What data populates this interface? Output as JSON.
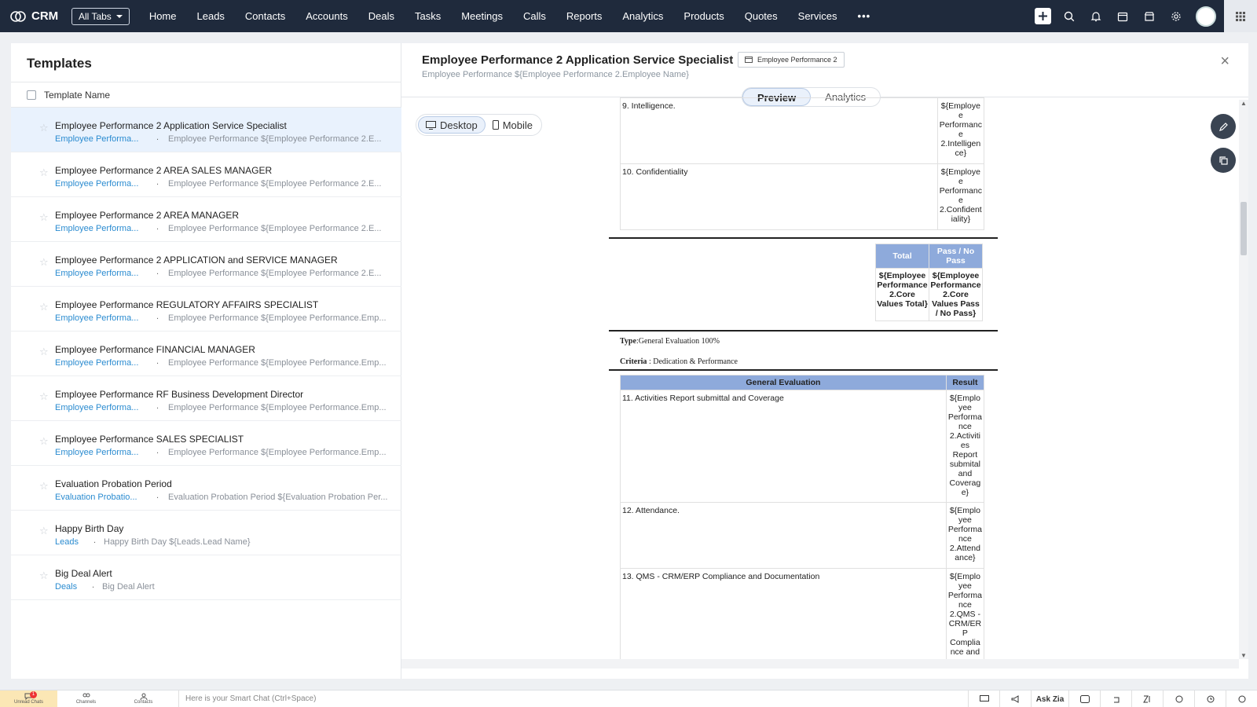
{
  "topbar": {
    "brand": "CRM",
    "all_tabs": "All Tabs",
    "nav": [
      "Home",
      "Leads",
      "Contacts",
      "Accounts",
      "Deals",
      "Tasks",
      "Meetings",
      "Calls",
      "Reports",
      "Analytics",
      "Products",
      "Quotes",
      "Services"
    ],
    "more": "•••",
    "icons": [
      "plus-icon",
      "search-icon",
      "bell-icon",
      "calendar-icon",
      "store-icon",
      "gear-icon",
      "avatar",
      "apps-grid-icon"
    ]
  },
  "templates": {
    "title": "Templates",
    "column_header": "Template Name",
    "items": [
      {
        "name": "Employee Performance 2 Application Service Specialist",
        "module": "Employee Performa...",
        "subject": "Employee Performance ${Employee Performance 2.E..."
      },
      {
        "name": "Employee Performance 2 AREA SALES MANAGER",
        "module": "Employee Performa...",
        "subject": "Employee Performance ${Employee Performance 2.E..."
      },
      {
        "name": "Employee Performance 2 AREA MANAGER",
        "module": "Employee Performa...",
        "subject": "Employee Performance ${Employee Performance 2.E..."
      },
      {
        "name": "Employee Performance 2 APPLICATION and SERVICE MANAGER",
        "module": "Employee Performa...",
        "subject": "Employee Performance ${Employee Performance 2.E..."
      },
      {
        "name": "Employee Performance REGULATORY AFFAIRS SPECIALIST",
        "module": "Employee Performa...",
        "subject": "Employee Performance ${Employee Performance.Emp..."
      },
      {
        "name": "Employee Performance FINANCIAL MANAGER",
        "module": "Employee Performa...",
        "subject": "Employee Performance ${Employee Performance.Emp..."
      },
      {
        "name": "Employee Performance RF Business Development Director",
        "module": "Employee Performa...",
        "subject": "Employee Performance ${Employee Performance.Emp..."
      },
      {
        "name": "Employee Performance SALES SPECIALIST",
        "module": "Employee Performa...",
        "subject": "Employee Performance ${Employee Performance.Emp..."
      },
      {
        "name": "Evaluation Probation Period",
        "module": "Evaluation Probatio...",
        "subject": "Evaluation Probation Period ${Evaluation Probation Per..."
      },
      {
        "name": "Happy Birth Day",
        "module": "Leads",
        "subject": "Happy Birth Day ${Leads.Lead Name}"
      },
      {
        "name": "Big Deal Alert",
        "module": "Deals",
        "subject": "Big Deal Alert"
      }
    ],
    "dot": "."
  },
  "preview": {
    "title": "Employee Performance 2 Application Service Specialist",
    "module_badge": "Employee Performance 2",
    "subject": "Employee Performance ${Employee Performance 2.Employee Name}",
    "close": "×",
    "tabs": [
      "Preview",
      "Analytics"
    ],
    "devices": [
      "Desktop",
      "Mobile"
    ]
  },
  "document": {
    "rows_a": [
      {
        "label": "9. Intelligence.",
        "result": "${Employe e Performanc e 2.Intelligen ce}"
      },
      {
        "label": "10. Confidentiality",
        "result": "${Employe e Performanc e 2.Confident iality}"
      }
    ],
    "totals": {
      "headers": [
        "Total",
        "Pass / No Pass"
      ],
      "values": [
        "${Employee Performance 2.Core Values Total}",
        "${Employee Performance 2.Core Values Pass / No Pass}"
      ]
    },
    "type_label": "Type",
    "type_value": ":General  Evaluation 100%",
    "criteria_label": "Criteria",
    "criteria_value": " : Dedication & Performance",
    "table_b_headers": [
      "General Evaluation",
      "Result"
    ],
    "rows_b": [
      {
        "label": "11.   Activities Report submittal and  Coverage",
        "result": "${Emplo yee Performa nce 2.Activiti es Report submital and Coverag e}"
      },
      {
        "label": "12.   Attendance.",
        "result": "${Emplo yee Performa nce 2.Attend ance}"
      },
      {
        "label": "13.   QMS - CRM/ERP Compliance and Documentation",
        "result": "${Emplo yee Performa nce 2.QMS - CRM/ER P Complia nce and"
      }
    ]
  },
  "bottombar": {
    "items": [
      "Unread Chats",
      "Channels",
      "Contacts"
    ],
    "unread_count": "1",
    "smart_chat": "Here is your Smart Chat (Ctrl+Space)",
    "ask_zia": "Ask Zia"
  }
}
